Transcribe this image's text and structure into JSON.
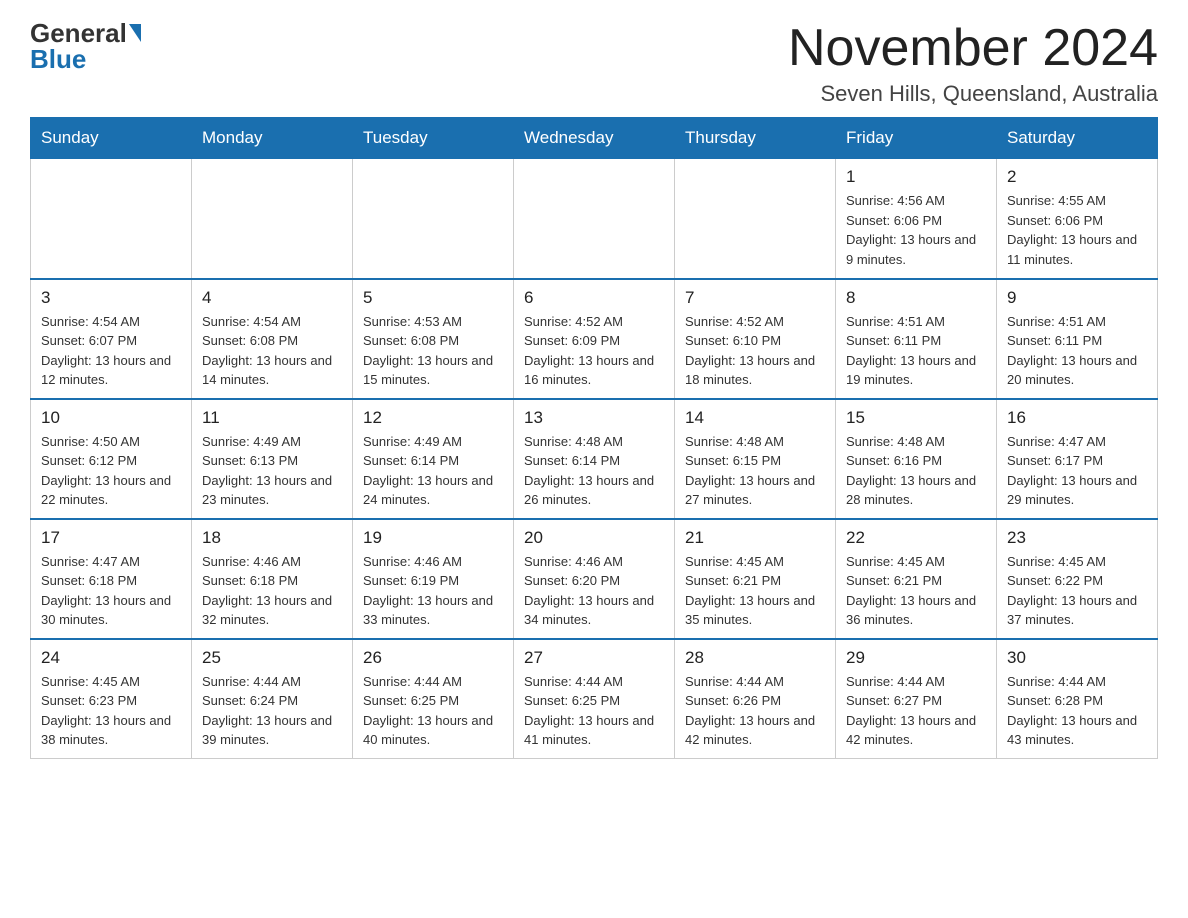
{
  "header": {
    "logo_general": "General",
    "logo_blue": "Blue",
    "month_title": "November 2024",
    "subtitle": "Seven Hills, Queensland, Australia"
  },
  "days_of_week": [
    "Sunday",
    "Monday",
    "Tuesday",
    "Wednesday",
    "Thursday",
    "Friday",
    "Saturday"
  ],
  "weeks": [
    [
      {
        "day": "",
        "sunrise": "",
        "sunset": "",
        "daylight": ""
      },
      {
        "day": "",
        "sunrise": "",
        "sunset": "",
        "daylight": ""
      },
      {
        "day": "",
        "sunrise": "",
        "sunset": "",
        "daylight": ""
      },
      {
        "day": "",
        "sunrise": "",
        "sunset": "",
        "daylight": ""
      },
      {
        "day": "",
        "sunrise": "",
        "sunset": "",
        "daylight": ""
      },
      {
        "day": "1",
        "sunrise": "Sunrise: 4:56 AM",
        "sunset": "Sunset: 6:06 PM",
        "daylight": "Daylight: 13 hours and 9 minutes."
      },
      {
        "day": "2",
        "sunrise": "Sunrise: 4:55 AM",
        "sunset": "Sunset: 6:06 PM",
        "daylight": "Daylight: 13 hours and 11 minutes."
      }
    ],
    [
      {
        "day": "3",
        "sunrise": "Sunrise: 4:54 AM",
        "sunset": "Sunset: 6:07 PM",
        "daylight": "Daylight: 13 hours and 12 minutes."
      },
      {
        "day": "4",
        "sunrise": "Sunrise: 4:54 AM",
        "sunset": "Sunset: 6:08 PM",
        "daylight": "Daylight: 13 hours and 14 minutes."
      },
      {
        "day": "5",
        "sunrise": "Sunrise: 4:53 AM",
        "sunset": "Sunset: 6:08 PM",
        "daylight": "Daylight: 13 hours and 15 minutes."
      },
      {
        "day": "6",
        "sunrise": "Sunrise: 4:52 AM",
        "sunset": "Sunset: 6:09 PM",
        "daylight": "Daylight: 13 hours and 16 minutes."
      },
      {
        "day": "7",
        "sunrise": "Sunrise: 4:52 AM",
        "sunset": "Sunset: 6:10 PM",
        "daylight": "Daylight: 13 hours and 18 minutes."
      },
      {
        "day": "8",
        "sunrise": "Sunrise: 4:51 AM",
        "sunset": "Sunset: 6:11 PM",
        "daylight": "Daylight: 13 hours and 19 minutes."
      },
      {
        "day": "9",
        "sunrise": "Sunrise: 4:51 AM",
        "sunset": "Sunset: 6:11 PM",
        "daylight": "Daylight: 13 hours and 20 minutes."
      }
    ],
    [
      {
        "day": "10",
        "sunrise": "Sunrise: 4:50 AM",
        "sunset": "Sunset: 6:12 PM",
        "daylight": "Daylight: 13 hours and 22 minutes."
      },
      {
        "day": "11",
        "sunrise": "Sunrise: 4:49 AM",
        "sunset": "Sunset: 6:13 PM",
        "daylight": "Daylight: 13 hours and 23 minutes."
      },
      {
        "day": "12",
        "sunrise": "Sunrise: 4:49 AM",
        "sunset": "Sunset: 6:14 PM",
        "daylight": "Daylight: 13 hours and 24 minutes."
      },
      {
        "day": "13",
        "sunrise": "Sunrise: 4:48 AM",
        "sunset": "Sunset: 6:14 PM",
        "daylight": "Daylight: 13 hours and 26 minutes."
      },
      {
        "day": "14",
        "sunrise": "Sunrise: 4:48 AM",
        "sunset": "Sunset: 6:15 PM",
        "daylight": "Daylight: 13 hours and 27 minutes."
      },
      {
        "day": "15",
        "sunrise": "Sunrise: 4:48 AM",
        "sunset": "Sunset: 6:16 PM",
        "daylight": "Daylight: 13 hours and 28 minutes."
      },
      {
        "day": "16",
        "sunrise": "Sunrise: 4:47 AM",
        "sunset": "Sunset: 6:17 PM",
        "daylight": "Daylight: 13 hours and 29 minutes."
      }
    ],
    [
      {
        "day": "17",
        "sunrise": "Sunrise: 4:47 AM",
        "sunset": "Sunset: 6:18 PM",
        "daylight": "Daylight: 13 hours and 30 minutes."
      },
      {
        "day": "18",
        "sunrise": "Sunrise: 4:46 AM",
        "sunset": "Sunset: 6:18 PM",
        "daylight": "Daylight: 13 hours and 32 minutes."
      },
      {
        "day": "19",
        "sunrise": "Sunrise: 4:46 AM",
        "sunset": "Sunset: 6:19 PM",
        "daylight": "Daylight: 13 hours and 33 minutes."
      },
      {
        "day": "20",
        "sunrise": "Sunrise: 4:46 AM",
        "sunset": "Sunset: 6:20 PM",
        "daylight": "Daylight: 13 hours and 34 minutes."
      },
      {
        "day": "21",
        "sunrise": "Sunrise: 4:45 AM",
        "sunset": "Sunset: 6:21 PM",
        "daylight": "Daylight: 13 hours and 35 minutes."
      },
      {
        "day": "22",
        "sunrise": "Sunrise: 4:45 AM",
        "sunset": "Sunset: 6:21 PM",
        "daylight": "Daylight: 13 hours and 36 minutes."
      },
      {
        "day": "23",
        "sunrise": "Sunrise: 4:45 AM",
        "sunset": "Sunset: 6:22 PM",
        "daylight": "Daylight: 13 hours and 37 minutes."
      }
    ],
    [
      {
        "day": "24",
        "sunrise": "Sunrise: 4:45 AM",
        "sunset": "Sunset: 6:23 PM",
        "daylight": "Daylight: 13 hours and 38 minutes."
      },
      {
        "day": "25",
        "sunrise": "Sunrise: 4:44 AM",
        "sunset": "Sunset: 6:24 PM",
        "daylight": "Daylight: 13 hours and 39 minutes."
      },
      {
        "day": "26",
        "sunrise": "Sunrise: 4:44 AM",
        "sunset": "Sunset: 6:25 PM",
        "daylight": "Daylight: 13 hours and 40 minutes."
      },
      {
        "day": "27",
        "sunrise": "Sunrise: 4:44 AM",
        "sunset": "Sunset: 6:25 PM",
        "daylight": "Daylight: 13 hours and 41 minutes."
      },
      {
        "day": "28",
        "sunrise": "Sunrise: 4:44 AM",
        "sunset": "Sunset: 6:26 PM",
        "daylight": "Daylight: 13 hours and 42 minutes."
      },
      {
        "day": "29",
        "sunrise": "Sunrise: 4:44 AM",
        "sunset": "Sunset: 6:27 PM",
        "daylight": "Daylight: 13 hours and 42 minutes."
      },
      {
        "day": "30",
        "sunrise": "Sunrise: 4:44 AM",
        "sunset": "Sunset: 6:28 PM",
        "daylight": "Daylight: 13 hours and 43 minutes."
      }
    ]
  ]
}
